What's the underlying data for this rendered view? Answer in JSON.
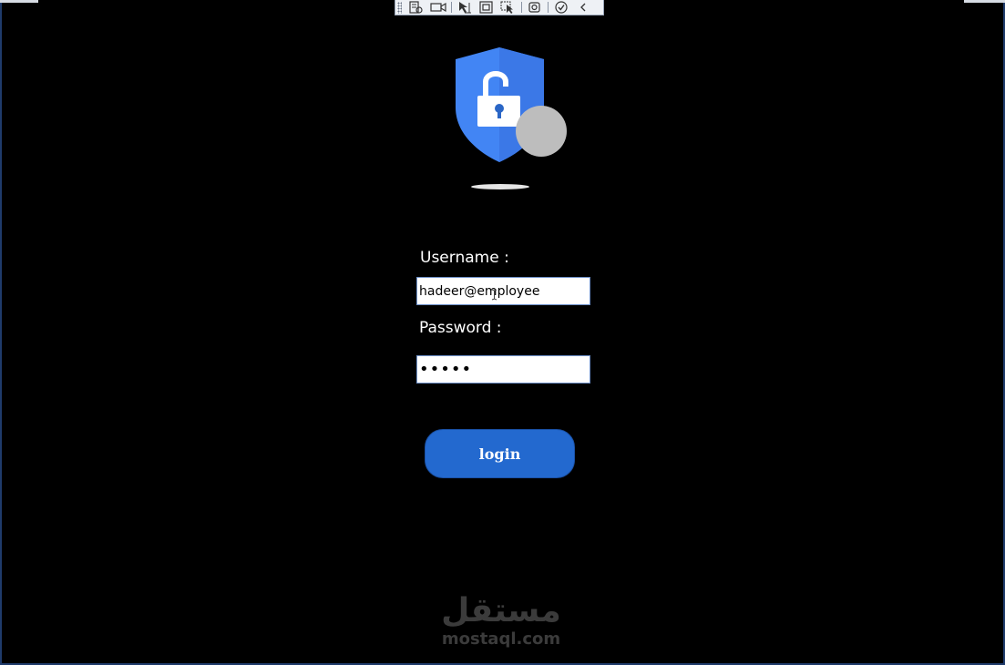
{
  "toolbar": {
    "icons": [
      "live-visual-tree-icon",
      "record-icon",
      "select-element-icon",
      "display-layout-adorners-icon",
      "track-focused-element-icon",
      "hot-reload-icon",
      "xaml-binding-check-icon",
      "collapse-icon"
    ]
  },
  "login_form": {
    "username_label": "Username :",
    "username_value": "hadeer@employee",
    "password_label": "Password :",
    "password_value": "•••••",
    "login_label": "login"
  },
  "watermark": {
    "arabic": "مستقل",
    "latin": "mostaql.com"
  },
  "colors": {
    "background": "#000000",
    "shield_blue": "#4285f4",
    "button_blue": "#2369cf",
    "circle_gray": "#bdbdbd"
  }
}
